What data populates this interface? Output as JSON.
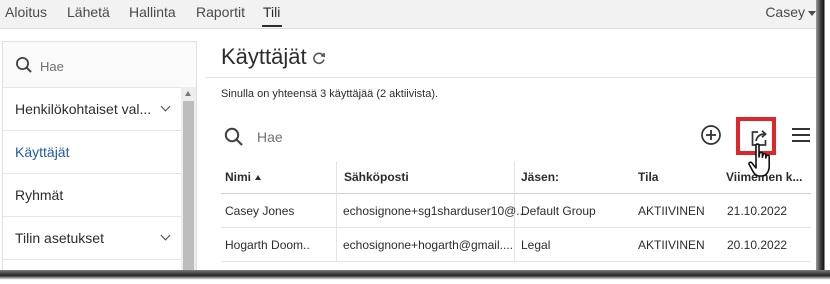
{
  "nav": {
    "items": [
      "Aloitus",
      "Lähetä",
      "Hallinta",
      "Raportit",
      "Tili"
    ],
    "active": "Tili",
    "user": "Casey"
  },
  "sidebar": {
    "search_placeholder": "Hae",
    "items": [
      {
        "label": "Henkilökohtaiset val...",
        "expandable": true
      },
      {
        "label": "Käyttäjät",
        "active": true
      },
      {
        "label": "Ryhmät"
      },
      {
        "label": "Tilin asetukset",
        "expandable": true
      }
    ]
  },
  "main": {
    "title": "Käyttäjät",
    "summary": "Sinulla on yhteensä 3 käyttäjää (2 aktiivista).",
    "search_placeholder": "Hae"
  },
  "table": {
    "headers": [
      "Nimi",
      "Sähköposti",
      "Jäsen:",
      "Tila",
      "Viimeinen k..."
    ],
    "rows": [
      [
        "Casey Jones",
        "echosignone+sg1sharduser10@...",
        "Default Group",
        "AKTIIVINEN",
        "21.10.2022"
      ],
      [
        "Hogarth Doom..",
        "echosignone+hogarth@gmail....",
        "Legal",
        "AKTIIVINEN",
        "20.10.2022"
      ]
    ]
  },
  "icons": {
    "refresh": "refresh-icon",
    "add": "add-circle-icon",
    "export": "export-icon",
    "menu": "hamburger-menu-icon",
    "cursor": "hand-cursor-icon"
  },
  "colors": {
    "active_link": "#1f5aa8",
    "highlight_box": "#e0242c"
  }
}
